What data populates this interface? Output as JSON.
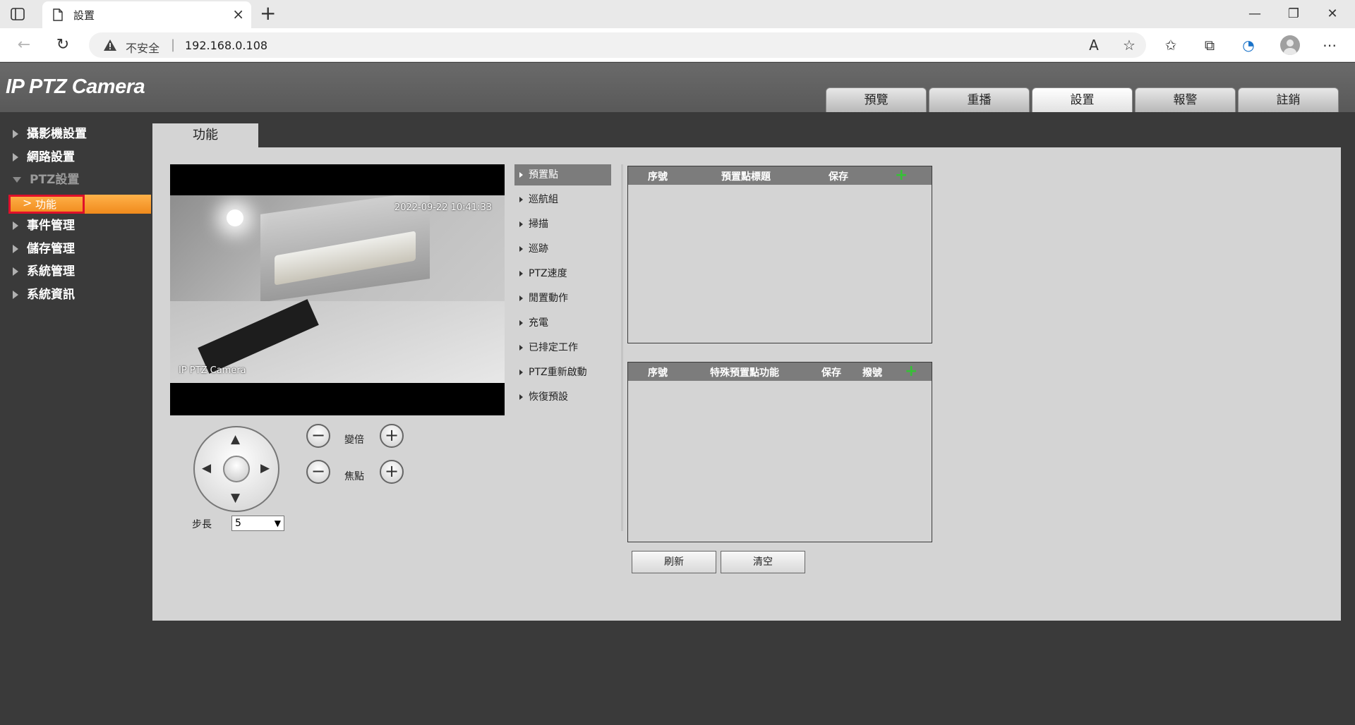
{
  "browser": {
    "tab_title": "設置",
    "url_warning": "不安全",
    "url_separator": "|",
    "url": "192.168.0.108"
  },
  "app": {
    "logo": "IP PTZ Camera",
    "main_tabs": [
      {
        "label": "預覽",
        "active": false
      },
      {
        "label": "重播",
        "active": false
      },
      {
        "label": "設置",
        "active": true
      },
      {
        "label": "報警",
        "active": false
      },
      {
        "label": "註銷",
        "active": false
      }
    ]
  },
  "sidebar": {
    "items": [
      {
        "label": "攝影機設置"
      },
      {
        "label": "網路設置"
      },
      {
        "label": "PTZ設置"
      },
      {
        "label": "事件管理"
      },
      {
        "label": "儲存管理"
      },
      {
        "label": "系統管理"
      },
      {
        "label": "系統資訊"
      }
    ],
    "sub_item": "功能",
    "sub_chevron": ">"
  },
  "content": {
    "tab": "功能",
    "video": {
      "timestamp": "2022-09-22 10:41:33",
      "camera_name": "IP PTZ Camera"
    },
    "ptz": {
      "zoom_label": "變倍",
      "focus_label": "焦點",
      "minus": "−",
      "plus": "+",
      "step_label": "步長",
      "step_value": "5",
      "arrow_up": "▲",
      "arrow_down": "▼",
      "arrow_left": "◀",
      "arrow_right": "▶"
    },
    "function_menu": [
      {
        "label": "預置點",
        "active": true
      },
      {
        "label": "巡航組"
      },
      {
        "label": "掃描"
      },
      {
        "label": "巡跡"
      },
      {
        "label": "PTZ速度"
      },
      {
        "label": "閒置動作"
      },
      {
        "label": "充電"
      },
      {
        "label": "已排定工作"
      },
      {
        "label": "PTZ重新啟動"
      },
      {
        "label": "恢復預設"
      }
    ],
    "preset_table": {
      "headers": [
        "序號",
        "預置點標題",
        "保存"
      ],
      "add_symbol": "+"
    },
    "special_table": {
      "headers": [
        "序號",
        "特殊預置點功能",
        "保存",
        "撥號"
      ],
      "add_symbol": "+"
    },
    "buttons": {
      "refresh": "刷新",
      "clear": "清空"
    }
  }
}
